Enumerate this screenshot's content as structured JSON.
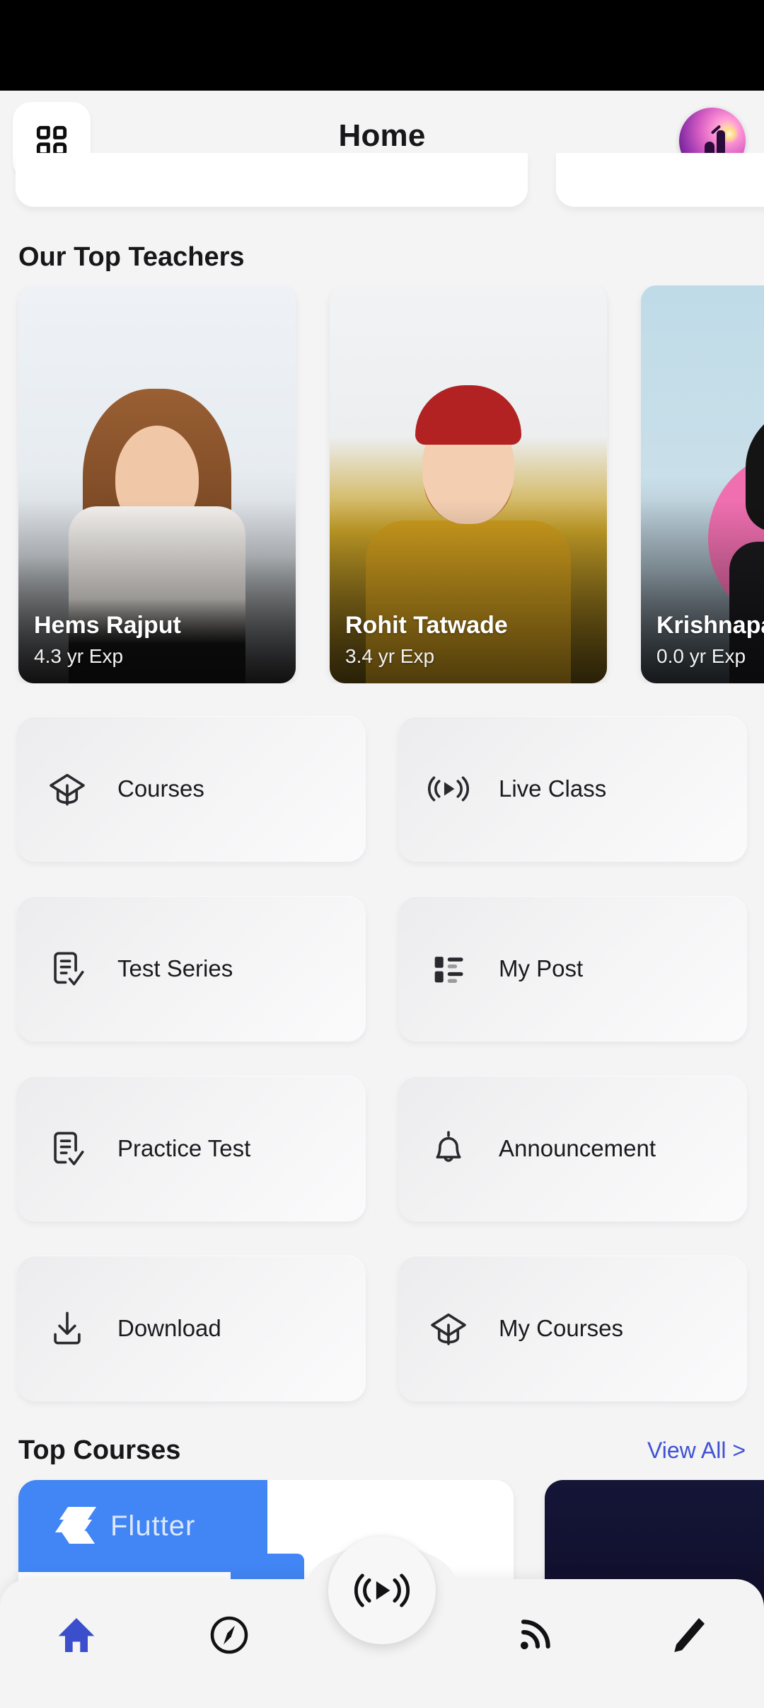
{
  "app": {
    "title": "Home",
    "menu_icon": "grid-menu-icon",
    "avatar_icon": "profile-avatar"
  },
  "sections": {
    "teachers_title": "Our Top Teachers",
    "courses_title": "Top Courses",
    "view_all": "View All >"
  },
  "teachers": [
    {
      "name": "Hems Rajput",
      "experience": "4.3 yr Exp"
    },
    {
      "name": "Rohit Tatwade",
      "experience": "3.4 yr Exp"
    },
    {
      "name": "Krishnapa",
      "experience": "0.0 yr Exp"
    }
  ],
  "menu": [
    {
      "label": "Courses",
      "icon": "graduation-cap-icon"
    },
    {
      "label": "Live Class",
      "icon": "live-broadcast-icon"
    },
    {
      "label": "Test Series",
      "icon": "document-check-icon"
    },
    {
      "label": "My Post",
      "icon": "feed-list-icon"
    },
    {
      "label": "Practice Test",
      "icon": "document-check-icon"
    },
    {
      "label": "Announcement",
      "icon": "bell-icon"
    },
    {
      "label": "Download",
      "icon": "download-icon"
    },
    {
      "label": "My Courses",
      "icon": "graduation-cap-icon"
    }
  ],
  "courses": [
    {
      "title": "Flutter"
    },
    {
      "title": ""
    }
  ],
  "bottom_nav": [
    {
      "icon": "home-icon",
      "active": true
    },
    {
      "icon": "compass-icon",
      "active": false
    },
    {
      "icon": "rss-feed-icon",
      "active": false
    },
    {
      "icon": "pencil-icon",
      "active": false
    }
  ],
  "fab": {
    "icon": "live-broadcast-icon"
  },
  "colors": {
    "background": "#f4f4f5",
    "accent": "#3f51d5",
    "text": "#17171a",
    "statusbar": "#000000",
    "flutter_blue": "#4285f4",
    "dark_card": "#0b0b22"
  }
}
